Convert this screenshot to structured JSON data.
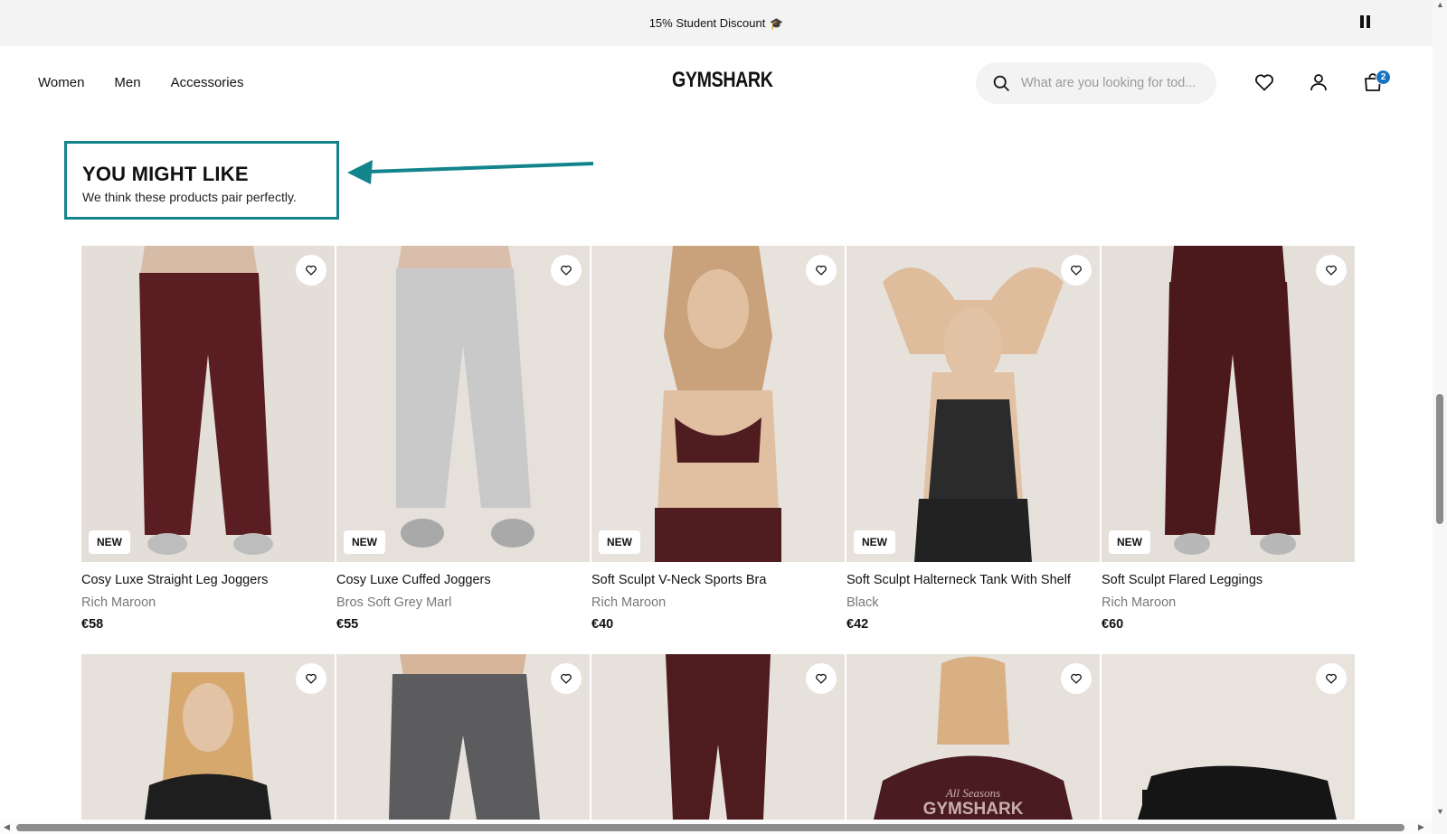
{
  "announcement": {
    "text": "15% Student Discount",
    "icon": "graduation-cap-icon",
    "pause_icon": "pause-icon"
  },
  "header": {
    "nav": [
      "Women",
      "Men",
      "Accessories"
    ],
    "logo": "GYMSHARK",
    "search_placeholder": "What are you looking for tod...",
    "cart_count": "2",
    "accent_color": "#1874c3"
  },
  "section": {
    "title": "YOU MIGHT LIKE",
    "subtitle": "We think these products pair perfectly.",
    "highlight_color": "#13848b"
  },
  "products_row1": [
    {
      "badge": "NEW",
      "name": "Cosy Luxe Straight Leg Joggers",
      "color": "Rich Maroon",
      "price": "€58"
    },
    {
      "badge": "NEW",
      "name": "Cosy Luxe Cuffed Joggers",
      "color": "Bros Soft Grey Marl",
      "price": "€55"
    },
    {
      "badge": "NEW",
      "name": "Soft Sculpt V-Neck Sports Bra",
      "color": "Rich Maroon",
      "price": "€40"
    },
    {
      "badge": "NEW",
      "name": "Soft Sculpt Halterneck Tank With Shelf",
      "color": "Black",
      "price": "€42"
    },
    {
      "badge": "NEW",
      "name": "Soft Sculpt Flared Leggings",
      "color": "Rich Maroon",
      "price": "€60"
    }
  ],
  "products_row2_images": [
    "black-crop-top-image",
    "grey-track-pants-image",
    "maroon-leggings-image",
    "maroon-graphic-tee-image",
    "black-bag-image"
  ],
  "row2_tee_print": "GYMSHARK",
  "row2_tee_script": "All Seasons"
}
